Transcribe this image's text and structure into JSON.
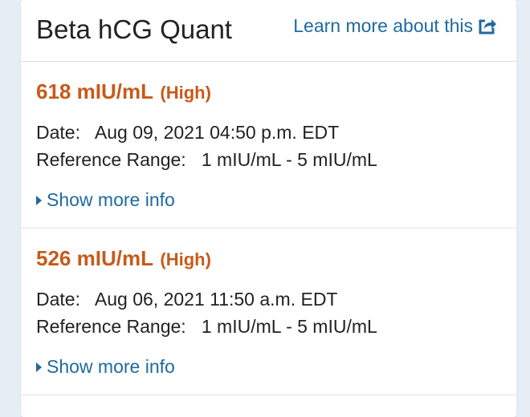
{
  "header": {
    "title": "Beta hCG Quant",
    "learn_more": "Learn more about this"
  },
  "results": [
    {
      "value": "618 mIU/mL",
      "flag": "(High)",
      "date_label": "Date:",
      "date_value": "Aug 09, 2021 04:50 p.m. EDT",
      "range_label": "Reference Range:",
      "range_value": "1 mIU/mL - 5 mIU/mL",
      "show_more": "Show more info"
    },
    {
      "value": "526 mIU/mL",
      "flag": "(High)",
      "date_label": "Date:",
      "date_value": "Aug 06, 2021 11:50 a.m. EDT",
      "range_label": "Reference Range:",
      "range_value": "1 mIU/mL - 5 mIU/mL",
      "show_more": "Show more info"
    }
  ],
  "colors": {
    "background": "#e6eef5",
    "link": "#1f6a9e",
    "high_value": "#c75a1a"
  },
  "icons": {
    "learn_more": "external-share-icon",
    "expand": "caret-right-icon"
  }
}
